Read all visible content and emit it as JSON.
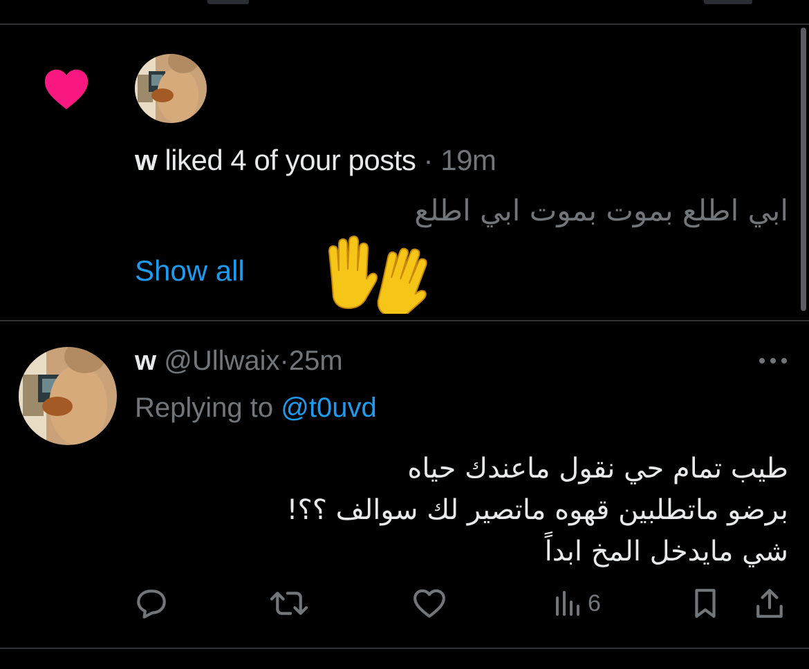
{
  "notification": {
    "user_name": "w",
    "action_text": "liked 4 of your posts",
    "separator": "·",
    "time": "19m",
    "preview_text": "ابي اطلع بموت بموت ابي اطلع",
    "show_all_label": "Show all"
  },
  "tweet": {
    "user_name": "w",
    "handle": "@Ullwaix",
    "separator": "·",
    "time": "25m",
    "replying_prefix": "Replying to",
    "replying_mention": "@t0uvd",
    "body_lines": [
      "طيب تمام حي نقول ماعندك حياه",
      "برضو ماتطلبين قهوه ماتصير لك سوالف ؟؟!",
      "شي مايدخل المخ ابداً"
    ],
    "views_count": "6"
  },
  "icons": {
    "notification_type": "heart-icon",
    "actions": [
      "reply-icon",
      "retweet-icon",
      "like-icon",
      "views-icon",
      "bookmark-icon",
      "share-icon"
    ],
    "more": "more-icon"
  },
  "colors": {
    "background": "#000000",
    "accent": "#1d9bf0",
    "heart": "#f91880",
    "muted_text": "#71767b",
    "primary_text": "#e7e9ea",
    "divider": "#2f3336"
  }
}
